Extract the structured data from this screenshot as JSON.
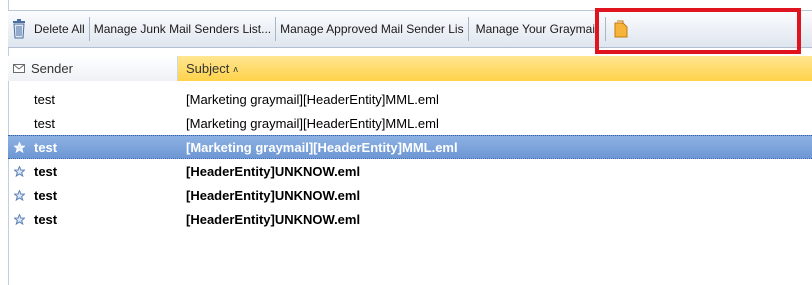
{
  "toolbar": {
    "delete_all": "Delete All",
    "manage_junk": "Manage Junk Mail Senders List...",
    "manage_approved": "Manage Approved Mail Sender Lis",
    "manage_graymail": "Manage Your Graymail",
    "highlight_color": "#e0141e"
  },
  "grid": {
    "columns": {
      "sender": "Sender",
      "subject": "Subject"
    },
    "sort_indicator": "ʌ",
    "selected_color": "#7aa3dc",
    "header_sorted_color": "#ffd24a",
    "rows": [
      {
        "sender": "test",
        "subject": "[Marketing graymail][HeaderEntity]MML.eml",
        "unread": false,
        "selected": false,
        "flag": ""
      },
      {
        "sender": "test",
        "subject": "[Marketing graymail][HeaderEntity]MML.eml",
        "unread": false,
        "selected": false,
        "flag": ""
      },
      {
        "sender": "test",
        "subject": "[Marketing graymail][HeaderEntity]MML.eml",
        "unread": true,
        "selected": true,
        "flag": "star-icon"
      },
      {
        "sender": "test",
        "subject": "[HeaderEntity]UNKNOW.eml",
        "unread": true,
        "selected": false,
        "flag": "star-icon"
      },
      {
        "sender": "test",
        "subject": "[HeaderEntity]UNKNOW.eml",
        "unread": true,
        "selected": false,
        "flag": "star-icon"
      },
      {
        "sender": "test",
        "subject": "[HeaderEntity]UNKNOW.eml",
        "unread": true,
        "selected": false,
        "flag": "star-icon"
      }
    ]
  }
}
